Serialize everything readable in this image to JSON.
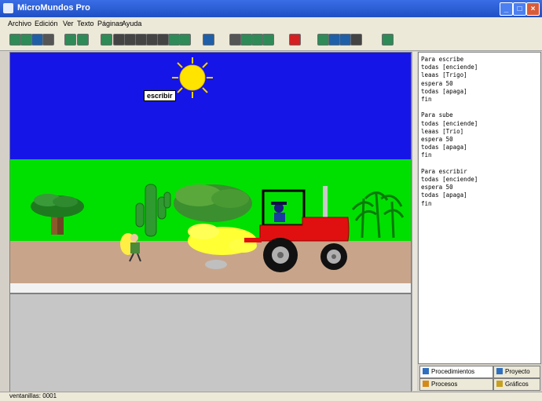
{
  "window": {
    "title": "MicroMundos Pro"
  },
  "menu": [
    "Archivo",
    "Edición",
    "Ver",
    "Texto",
    "Páginas",
    "Ayuda"
  ],
  "toolbar": {
    "tools": [
      {
        "name": "new-page-icon",
        "color": "#2e8b57"
      },
      {
        "name": "open-icon",
        "color": "#2e8b57"
      },
      {
        "name": "save-icon",
        "color": "#1f5fa8"
      },
      {
        "name": "print-icon",
        "color": "#555555"
      },
      {
        "name": "cut-icon",
        "color": "#2e8b57"
      },
      {
        "name": "copy-icon",
        "color": "#2e8b57"
      },
      {
        "name": "turtle-icon",
        "color": "#2e8b57"
      },
      {
        "name": "button-icon",
        "color": "#444444"
      },
      {
        "name": "text-icon",
        "color": "#444444"
      },
      {
        "name": "slider-icon",
        "color": "#444444"
      },
      {
        "name": "music-icon",
        "color": "#444444"
      },
      {
        "name": "video-icon",
        "color": "#444444"
      },
      {
        "name": "sound-icon",
        "color": "#2e8b57"
      },
      {
        "name": "record-icon",
        "color": "#2e8b57"
      },
      {
        "name": "pointer-icon",
        "color": "#1f5fa8"
      },
      {
        "name": "eye-icon",
        "color": "#555555"
      },
      {
        "name": "paint-icon",
        "color": "#2e8b57"
      },
      {
        "name": "scissors-icon",
        "color": "#2e8b57"
      },
      {
        "name": "stretch-icon",
        "color": "#2e8b57"
      },
      {
        "name": "stop-icon",
        "color": "#d42020"
      },
      {
        "name": "checkmark-icon",
        "color": "#2e8b57"
      },
      {
        "name": "shapes-icon",
        "color": "#1f5fa8"
      },
      {
        "name": "graphics-icon",
        "color": "#1f5fa8"
      },
      {
        "name": "undo-icon",
        "color": "#444444"
      },
      {
        "name": "help-icon",
        "color": "#2e8b57"
      }
    ]
  },
  "scene": {
    "sky_color": "#1515e8",
    "grass_color": "#00e000",
    "ground_color": "#c8a58a",
    "label_text": "escribir"
  },
  "procedures": "Para escribe\ntodas [enciende]\nleaas [Trigo]\nespera 50\ntodas [apaga]\nfin\n\nPara sube\ntodas [enciende]\nleaas [Trio]\nespera 50\ntodas [apaga]\nfin\n\nPara escribir\ntodas [enciende]\nespera 50\ntodas [apaga]\nfin",
  "tabs": {
    "procedimientos": "Procedimientos",
    "proyecto": "Proyecto",
    "procesos": "Procesos",
    "graficos": "Gráficos"
  },
  "status": {
    "text": "ventanillas: 0001"
  }
}
